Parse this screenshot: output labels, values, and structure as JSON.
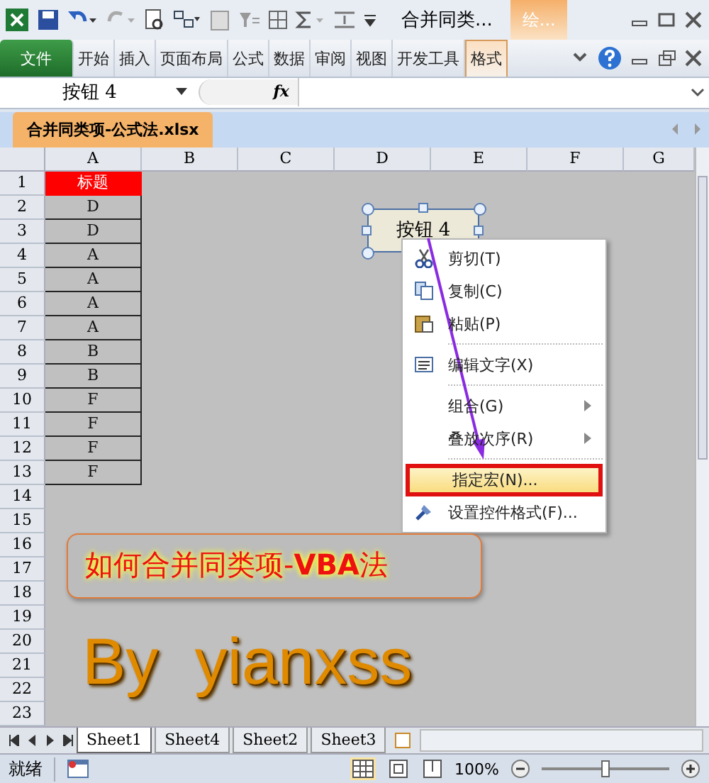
{
  "title_bar": {
    "title": "合并同类...",
    "context_tab": "绘..."
  },
  "ribbon_tabs": [
    {
      "label": "文件",
      "kind": "file",
      "selected": false
    },
    {
      "label": "开始",
      "kind": "normal",
      "selected": false
    },
    {
      "label": "插入",
      "kind": "normal",
      "selected": false
    },
    {
      "label": "页面布局",
      "kind": "normal",
      "selected": false
    },
    {
      "label": "公式",
      "kind": "normal",
      "selected": false
    },
    {
      "label": "数据",
      "kind": "normal",
      "selected": false
    },
    {
      "label": "审阅",
      "kind": "normal",
      "selected": false
    },
    {
      "label": "视图",
      "kind": "normal",
      "selected": false
    },
    {
      "label": "开发工具",
      "kind": "normal",
      "selected": false
    },
    {
      "label": "格式",
      "kind": "context",
      "selected": true
    }
  ],
  "formula_bar": {
    "name_box": "按钮 4",
    "function_label": "fx"
  },
  "workbook_tab": "合并同类项-公式法.xlsx",
  "columns": [
    "A",
    "B",
    "C",
    "D",
    "E",
    "F",
    "G"
  ],
  "rows": [
    {
      "number": "1",
      "cell_a": "标题",
      "kind": "title"
    },
    {
      "number": "2",
      "cell_a": "D",
      "kind": "value"
    },
    {
      "number": "3",
      "cell_a": "D",
      "kind": "value"
    },
    {
      "number": "4",
      "cell_a": "A",
      "kind": "value"
    },
    {
      "number": "5",
      "cell_a": "A",
      "kind": "value"
    },
    {
      "number": "6",
      "cell_a": "A",
      "kind": "value"
    },
    {
      "number": "7",
      "cell_a": "A",
      "kind": "value"
    },
    {
      "number": "8",
      "cell_a": "B",
      "kind": "value"
    },
    {
      "number": "9",
      "cell_a": "B",
      "kind": "value"
    },
    {
      "number": "10",
      "cell_a": "F",
      "kind": "value"
    },
    {
      "number": "11",
      "cell_a": "F",
      "kind": "value"
    },
    {
      "number": "12",
      "cell_a": "F",
      "kind": "value"
    },
    {
      "number": "13",
      "cell_a": "F",
      "kind": "value"
    },
    {
      "number": "14",
      "kind": "empty"
    },
    {
      "number": "15",
      "kind": "empty"
    },
    {
      "number": "16",
      "kind": "empty"
    },
    {
      "number": "17",
      "kind": "empty"
    },
    {
      "number": "18",
      "kind": "empty"
    },
    {
      "number": "19",
      "kind": "empty"
    },
    {
      "number": "20",
      "kind": "empty"
    },
    {
      "number": "21",
      "kind": "empty"
    },
    {
      "number": "22",
      "kind": "empty"
    },
    {
      "number": "23",
      "kind": "empty"
    }
  ],
  "form_button": {
    "label": "按钮 4",
    "selected": true
  },
  "context_menu": [
    {
      "label": "剪切(T)",
      "submenu": false,
      "highlighted": false,
      "separator_before": false
    },
    {
      "label": "复制(C)",
      "submenu": false,
      "highlighted": false,
      "separator_before": false
    },
    {
      "label": "粘贴(P)",
      "submenu": false,
      "highlighted": false,
      "separator_before": false
    },
    {
      "label": "编辑文字(X)",
      "submenu": false,
      "highlighted": false,
      "separator_before": true
    },
    {
      "label": "组合(G)",
      "submenu": true,
      "highlighted": false,
      "separator_before": true
    },
    {
      "label": "叠放次序(R)",
      "submenu": true,
      "highlighted": false,
      "separator_before": false
    },
    {
      "label": "指定宏(N)...",
      "submenu": false,
      "highlighted": true,
      "separator_before": true
    },
    {
      "label": "设置控件格式(F)...",
      "submenu": false,
      "highlighted": false,
      "separator_before": false
    }
  ],
  "title_art": "如何合并同类项-**VBA**法",
  "signature": "By  yianxss",
  "sheet_tabs": [
    {
      "label": "Sheet1",
      "selected": true
    },
    {
      "label": "Sheet4",
      "selected": false
    },
    {
      "label": "Sheet2",
      "selected": false
    },
    {
      "label": "Sheet3",
      "selected": false
    }
  ],
  "status_bar": {
    "status": "就绪",
    "zoom": "100%",
    "zoom_slider": {
      "level": 0.5
    }
  }
}
